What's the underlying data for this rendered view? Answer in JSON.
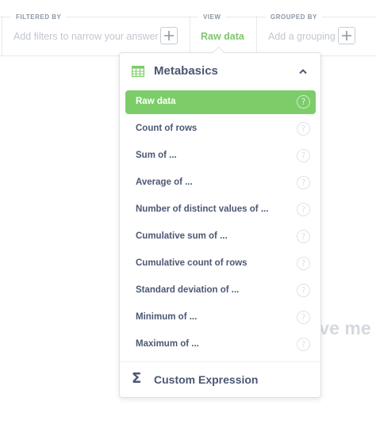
{
  "query_bar": {
    "filtered_by": {
      "label": "FILTERED BY",
      "placeholder": "Add filters to narrow your answer"
    },
    "view": {
      "label": "VIEW",
      "value": "Raw data"
    },
    "grouped_by": {
      "label": "GROUPED BY",
      "placeholder": "Add a grouping"
    }
  },
  "popover": {
    "title": "Metabasics",
    "options": [
      {
        "label": "Raw data",
        "selected": true
      },
      {
        "label": "Count of rows"
      },
      {
        "label": "Sum of ..."
      },
      {
        "label": "Average of ..."
      },
      {
        "label": "Number of distinct values of ..."
      },
      {
        "label": "Cumulative sum of ..."
      },
      {
        "label": "Cumulative count of rows"
      },
      {
        "label": "Standard deviation of ..."
      },
      {
        "label": "Minimum of ..."
      },
      {
        "label": "Maximum of ..."
      }
    ],
    "help_glyph": "?",
    "custom": {
      "symbol": "Σ",
      "label": "Custom Expression"
    }
  },
  "background_text": "ive me",
  "colors": {
    "accent_green": "#7ccd6a",
    "text": "#4c5773",
    "muted": "#c2c7ce"
  },
  "icons": [
    "plus-icon",
    "table-icon",
    "chevron-up-icon",
    "help-icon",
    "sigma-icon"
  ]
}
